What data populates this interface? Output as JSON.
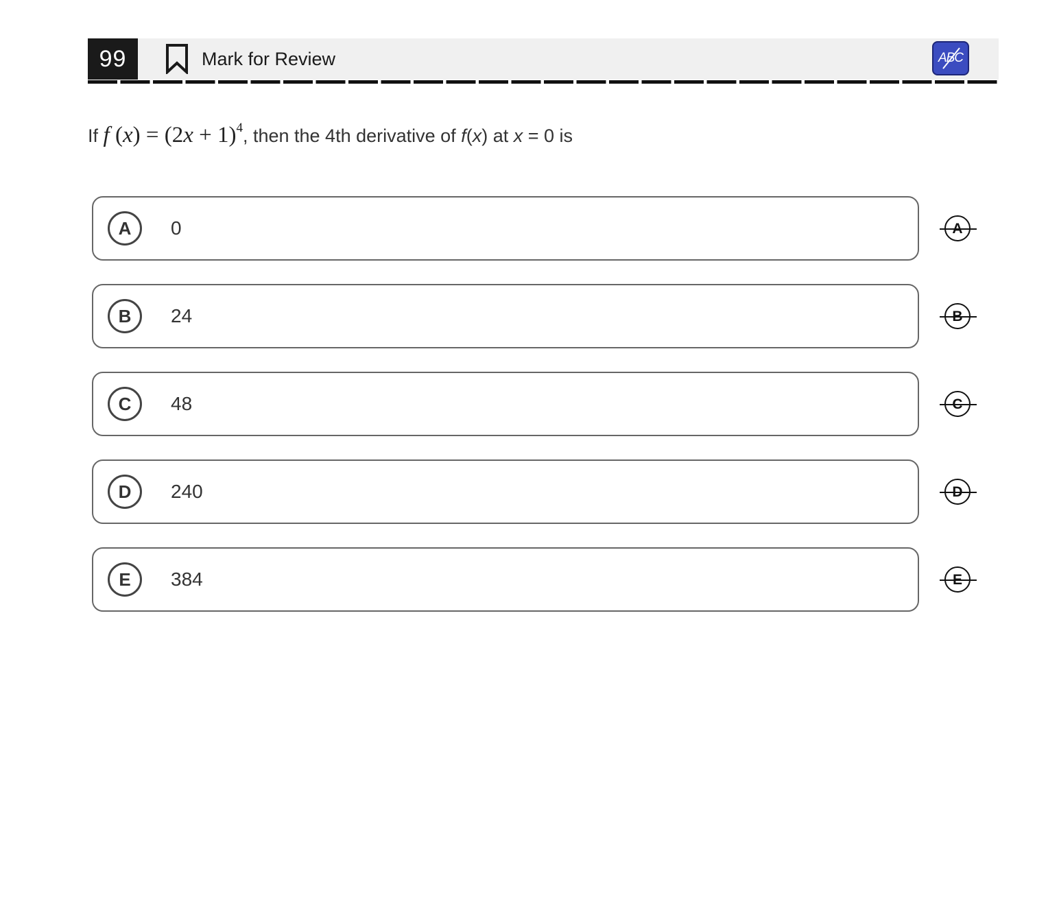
{
  "header": {
    "question_number": "99",
    "mark_for_review_label": "Mark for Review",
    "abc_button_label": "ABC",
    "abc_button_color": "#3b4cc0"
  },
  "question": {
    "prefix": "If ",
    "equation": {
      "fn": "f",
      "arg": "x",
      "coef": "2",
      "var": "x",
      "plus": "+",
      "const": "1",
      "exponent": "4"
    },
    "middle": ", then the 4th derivative of ",
    "fx_func": "f",
    "fx_arg": "x",
    "at_text": " at ",
    "at_var": "x",
    "tail": " = 0 is"
  },
  "choices": [
    {
      "letter": "A",
      "value": "0"
    },
    {
      "letter": "B",
      "value": "24"
    },
    {
      "letter": "C",
      "value": "48"
    },
    {
      "letter": "D",
      "value": "240"
    },
    {
      "letter": "E",
      "value": "384"
    }
  ]
}
